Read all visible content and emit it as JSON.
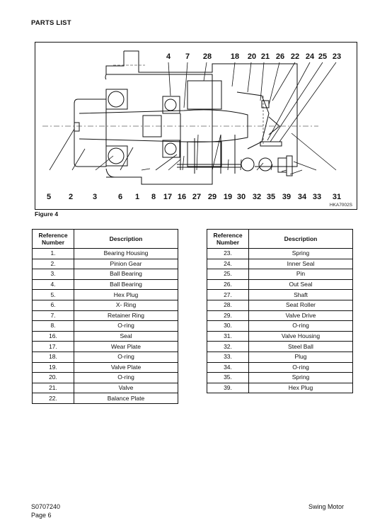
{
  "page": {
    "section_title": "PARTS LIST",
    "figure_caption": "Figure 4",
    "figure_code": "HKA7002S",
    "doc_number": "S0707240",
    "page_label": "Page 6",
    "doc_title": "Swing Motor"
  },
  "figure": {
    "top_callouts": [
      "4",
      "7",
      "28",
      "18",
      "20",
      "21",
      "26",
      "22",
      "24",
      "25",
      "23"
    ],
    "bottom_callouts": [
      "5",
      "2",
      "3",
      "6",
      "1",
      "8",
      "17",
      "16",
      "27",
      "29",
      "19",
      "30",
      "32",
      "35",
      "39",
      "34",
      "33",
      "31"
    ]
  },
  "tables": {
    "headers": {
      "ref": "Reference Number",
      "desc": "Description"
    },
    "left": [
      {
        "ref": "1.",
        "desc": "Bearing Housing"
      },
      {
        "ref": "2.",
        "desc": "Pinion Gear"
      },
      {
        "ref": "3.",
        "desc": "Ball Bearing"
      },
      {
        "ref": "4.",
        "desc": "Ball Bearing"
      },
      {
        "ref": "5.",
        "desc": "Hex Plug"
      },
      {
        "ref": "6.",
        "desc": "X- Ring"
      },
      {
        "ref": "7.",
        "desc": "Retainer Ring"
      },
      {
        "ref": "8.",
        "desc": "O-ring"
      },
      {
        "ref": "16.",
        "desc": "Seal"
      },
      {
        "ref": "17.",
        "desc": "Wear Plate"
      },
      {
        "ref": "18.",
        "desc": "O-ring"
      },
      {
        "ref": "19.",
        "desc": "Valve Plate"
      },
      {
        "ref": "20.",
        "desc": "O-ring"
      },
      {
        "ref": "21.",
        "desc": "Valve"
      },
      {
        "ref": "22.",
        "desc": "Balance Plate"
      }
    ],
    "right": [
      {
        "ref": "23.",
        "desc": "Spring"
      },
      {
        "ref": "24.",
        "desc": "Inner Seal"
      },
      {
        "ref": "25.",
        "desc": "Pin"
      },
      {
        "ref": "26.",
        "desc": "Out Seal"
      },
      {
        "ref": "27.",
        "desc": "Shaft"
      },
      {
        "ref": "28.",
        "desc": "Seat Roller"
      },
      {
        "ref": "29.",
        "desc": "Valve Drive"
      },
      {
        "ref": "30.",
        "desc": "O-ring"
      },
      {
        "ref": "31.",
        "desc": "Valve Housing"
      },
      {
        "ref": "32.",
        "desc": "Steel Ball"
      },
      {
        "ref": "33.",
        "desc": "Plug"
      },
      {
        "ref": "34.",
        "desc": "O-ring"
      },
      {
        "ref": "35.",
        "desc": "Spring"
      },
      {
        "ref": "39.",
        "desc": "Hex Plug"
      }
    ]
  }
}
